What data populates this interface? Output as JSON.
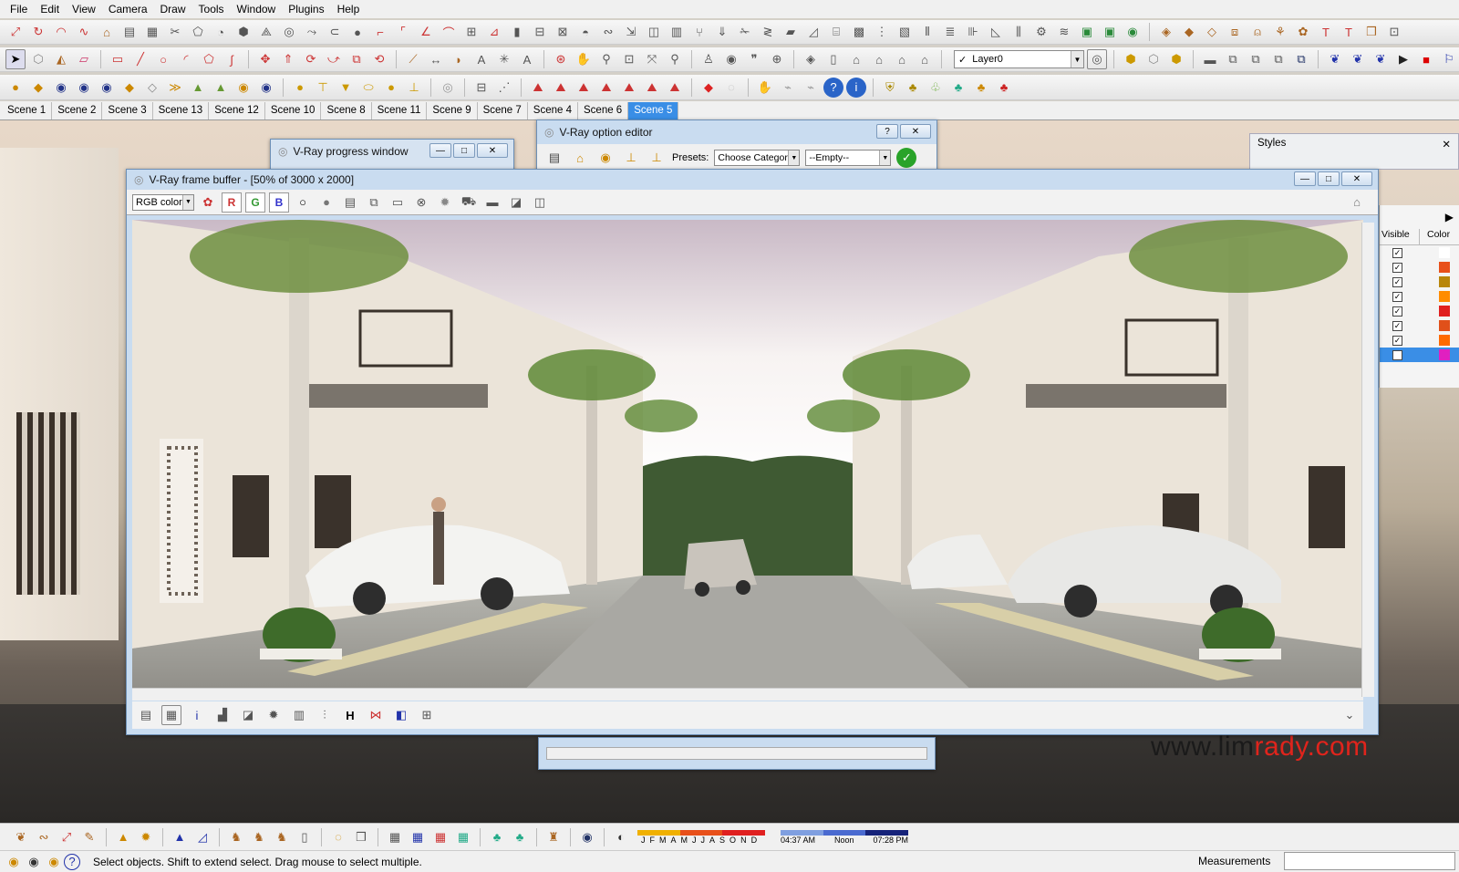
{
  "menu": [
    "File",
    "Edit",
    "View",
    "Camera",
    "Draw",
    "Tools",
    "Window",
    "Plugins",
    "Help"
  ],
  "layer": {
    "check": "✓",
    "name": "Layer0"
  },
  "scenes": [
    "Scene 1",
    "Scene 2",
    "Scene 3",
    "Scene 13",
    "Scene 12",
    "Scene 10",
    "Scene 8",
    "Scene 11",
    "Scene 9",
    "Scene 7",
    "Scene 4",
    "Scene 6",
    "Scene 5"
  ],
  "active_scene": "Scene 5",
  "progress_window": {
    "title": "V-Ray progress window"
  },
  "option_editor": {
    "title": "V-Ray option editor",
    "presets_label": "Presets:",
    "category": "Choose Categor",
    "preset": "--Empty--"
  },
  "frame_buffer": {
    "title": "V-Ray frame buffer - [50% of 3000 x 2000]",
    "channel": "RGB color",
    "r": "R",
    "g": "G",
    "b": "B"
  },
  "styles_panel": {
    "title": "Styles"
  },
  "layers_panel": {
    "col_visible": "Visible",
    "col_color": "Color",
    "rows": [
      {
        "visible": true,
        "color": "#ffffff"
      },
      {
        "visible": true,
        "color": "#e8501a"
      },
      {
        "visible": true,
        "color": "#b8860b"
      },
      {
        "visible": true,
        "color": "#ff8c00"
      },
      {
        "visible": true,
        "color": "#e02020"
      },
      {
        "visible": true,
        "color": "#e0501a"
      },
      {
        "visible": true,
        "color": "#ff6a00"
      },
      {
        "visible": false,
        "color": "#e020c0"
      }
    ]
  },
  "watermark": {
    "part1": "www.lim",
    "part2": "rady.com"
  },
  "shadow": {
    "months": [
      "J",
      "F",
      "M",
      "A",
      "M",
      "J",
      "J",
      "A",
      "S",
      "O",
      "N",
      "D"
    ],
    "time_start": "04:37 AM",
    "time_mid": "Noon",
    "time_end": "07:28 PM"
  },
  "status": {
    "hint": "Select objects. Shift to extend select. Drag mouse to select multiple.",
    "measurements_label": "Measurements"
  },
  "colors": {
    "accent": "#3a8ee6",
    "watermark_dark": "#1a1a1a",
    "watermark_red": "#e0241c"
  }
}
